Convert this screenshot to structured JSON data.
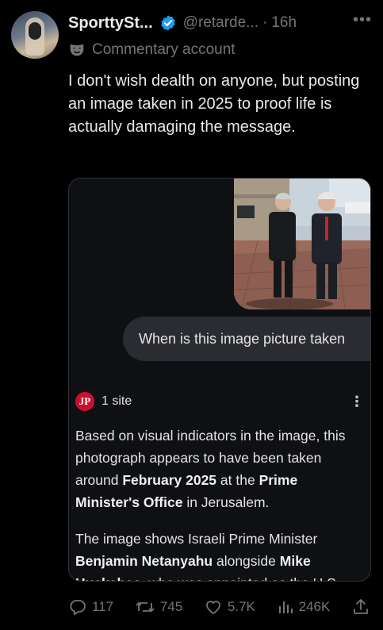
{
  "author": {
    "name": "SporttySt...",
    "handle": "@retarde...",
    "dot": "·",
    "time": "16h",
    "label": "Commentary account"
  },
  "more_label": "•••",
  "tweet_text": "I don't wish dealth on anyone, but posting an image taken in 2025 to proof life is actually damaging the message.",
  "card": {
    "user_question": "When is this image picture taken",
    "source_logo": "JP",
    "source_count": "1 site",
    "answer": {
      "p1_a": "Based on visual indicators in the image, this photograph appears to have been taken around ",
      "p1_b": "February 2025",
      "p1_c": " at the ",
      "p1_d": "Prime Minister's Office",
      "p1_e": " in Jerusalem.",
      "p2_a": "The image shows Israeli Prime Minister ",
      "p2_b": "Benjamin Netanyahu",
      "p2_c": " alongside ",
      "p2_d": "Mike",
      "p2_e": "Huckabee",
      "p2_f": ", who was appointed as the U.S."
    }
  },
  "actions": {
    "replies": "117",
    "reposts": "745",
    "likes": "5.7K",
    "views": "246K"
  },
  "colors": {
    "accent": "#1d9bf0",
    "muted": "#71767b",
    "bg": "#000000"
  }
}
